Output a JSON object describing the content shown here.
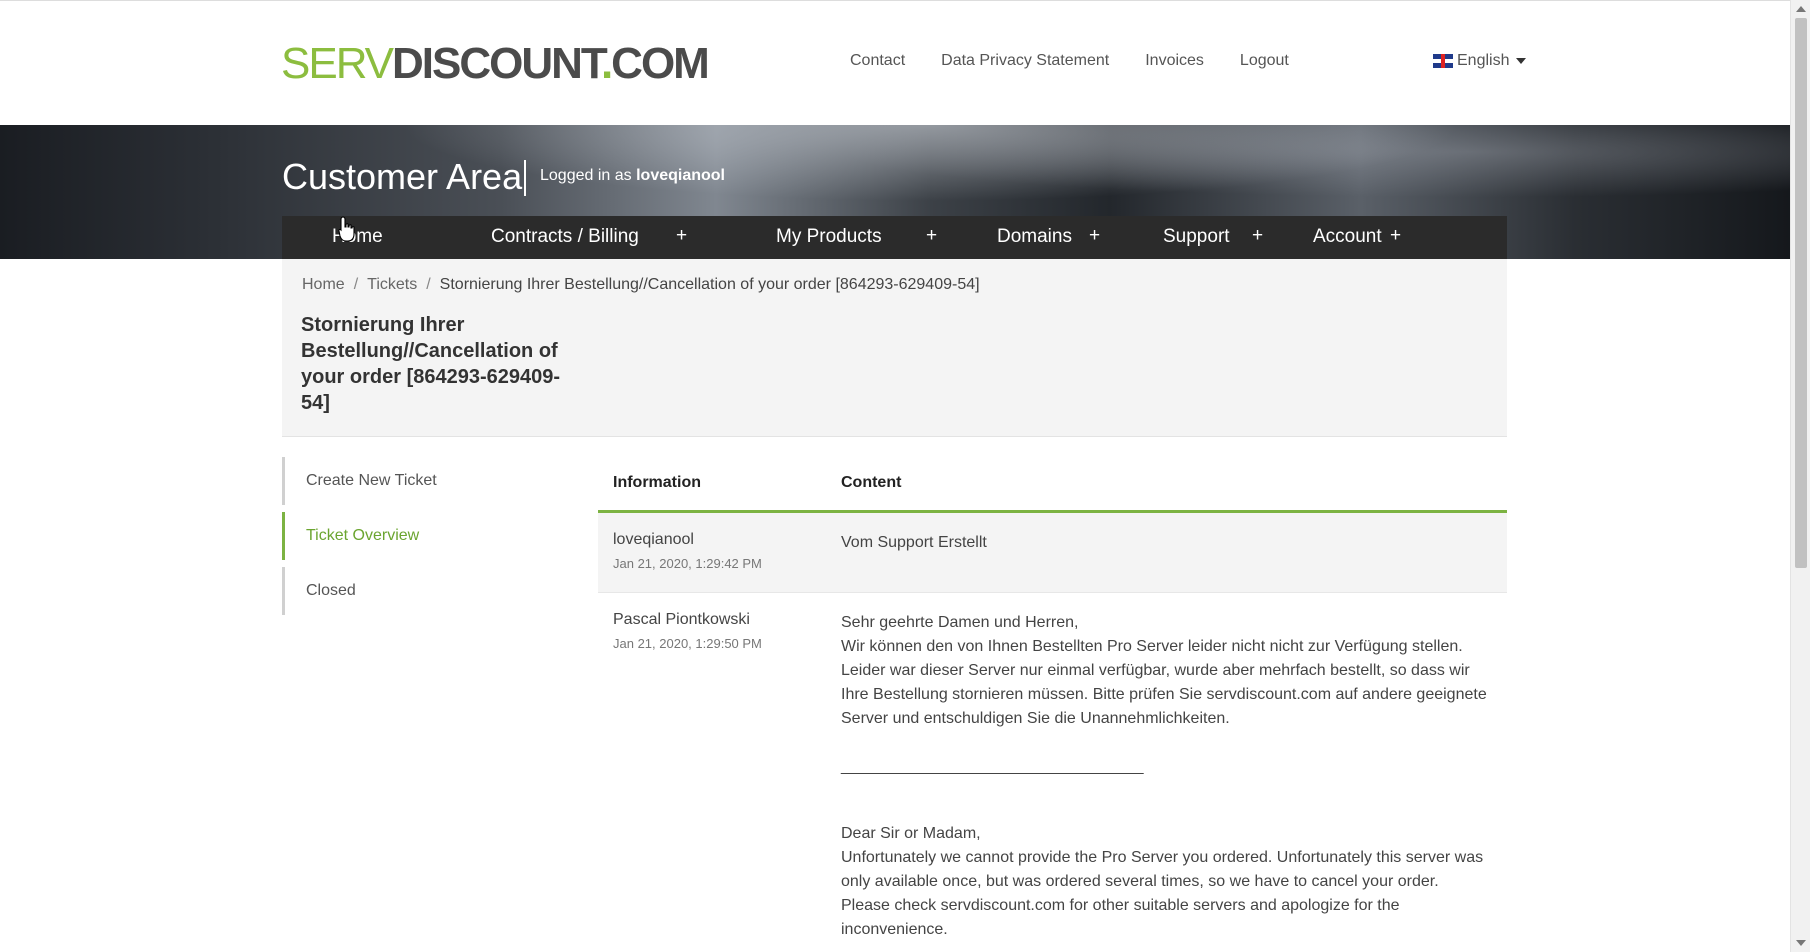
{
  "logo": {
    "part1": "SERV",
    "part2": "DISCOUNT",
    "part3": ".",
    "part4": "COM"
  },
  "top_nav": {
    "contact": "Contact",
    "privacy": "Data Privacy Statement",
    "invoices": "Invoices",
    "logout": "Logout"
  },
  "language": {
    "selected": "English",
    "icon": "uk-flag-icon"
  },
  "banner": {
    "title": "Customer Area",
    "logged_prefix": "Logged in as",
    "username": "loveqianool"
  },
  "main_nav": {
    "home": "Home",
    "contracts": "Contracts / Billing",
    "products": "My Products",
    "domains": "Domains",
    "support": "Support",
    "account": "Account",
    "plus": "+"
  },
  "breadcrumb": {
    "home": "Home",
    "tickets": "Tickets",
    "current": "Stornierung Ihrer Bestellung//Cancellation of your order [864293-629409-54]",
    "separator": "/"
  },
  "ticket": {
    "title": "Stornierung Ihrer Bestellung//Cancellation of your order [864293-629409-54]"
  },
  "sidebar": {
    "items": [
      {
        "label": "Create New Ticket",
        "active": false
      },
      {
        "label": "Ticket Overview",
        "active": true
      },
      {
        "label": "Closed",
        "active": false
      }
    ]
  },
  "table": {
    "headers": {
      "information": "Information",
      "content": "Content"
    },
    "rows": [
      {
        "author": "loveqianool",
        "date": "Jan 21, 2020, 1:29:42 PM",
        "content": "Vom Support Erstellt"
      },
      {
        "author": "Pascal Piontkowski",
        "date": "Jan 21, 2020, 1:29:50 PM",
        "greeting_de": "Sehr geehrte Damen und Herren,",
        "body_de": "Wir können den von Ihnen Bestellten Pro Server leider nicht nicht zur Verfügung stellen. Leider war dieser Server nur einmal verfügbar, wurde aber mehrfach bestellt, so dass wir Ihre Bestellung stornieren müssen. Bitte prüfen Sie servdiscount.com auf andere geeignete Server und entschuldigen Sie die Unannehmlichkeiten.",
        "divider": "__________________________________",
        "greeting_en": "Dear Sir or Madam,",
        "body_en": "Unfortunately we cannot provide the Pro Server you ordered. Unfortunately this server was only available once, but was ordered several times, so we have to cancel your order. Please check servdiscount.com for other suitable servers and apologize for the inconvenience."
      }
    ]
  },
  "colors": {
    "accent_green": "#7cb342",
    "nav_dark": "#2b2b2b",
    "panel_gray": "#f4f4f4"
  }
}
